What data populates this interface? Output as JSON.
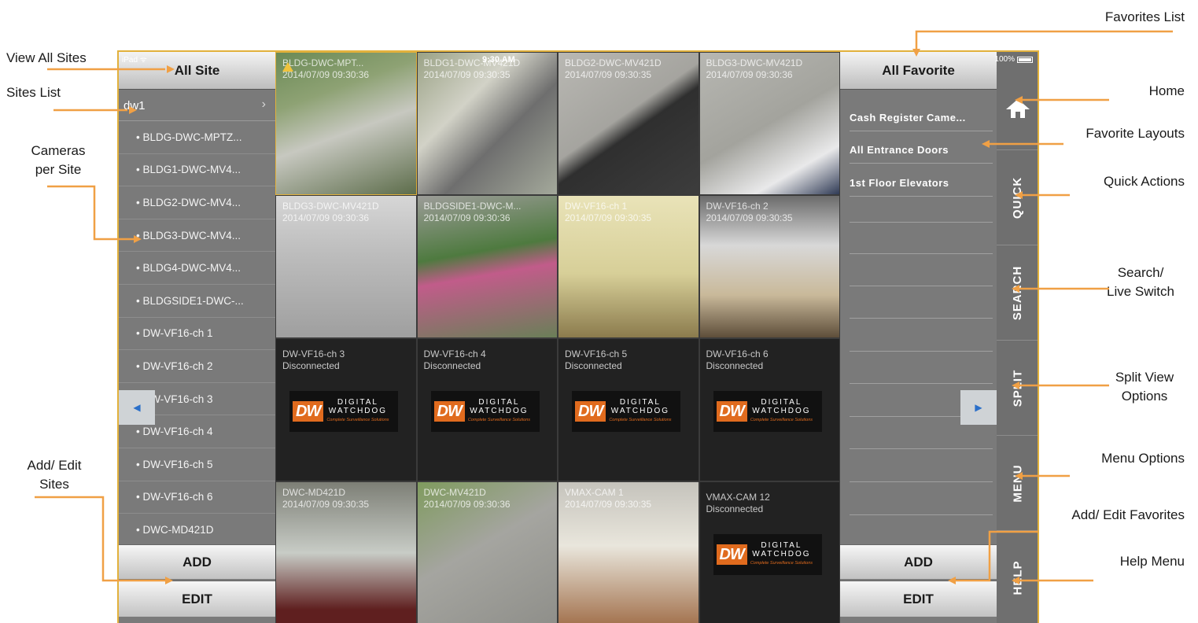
{
  "annotations": {
    "view_all_sites": "View All Sites",
    "sites_list": "Sites List",
    "cameras_per_site_1": "Cameras",
    "cameras_per_site_2": "per Site",
    "add_edit_sites_1": "Add/ Edit",
    "add_edit_sites_2": "Sites",
    "favorites_list": "Favorites List",
    "home": "Home",
    "favorite_layouts": "Favorite Layouts",
    "quick_actions": "Quick Actions",
    "search_live_1": "Search/",
    "search_live_2": "Live Switch",
    "split_view_1": "Split View",
    "split_view_2": "Options",
    "menu_options": "Menu Options",
    "add_edit_favorites": "Add/ Edit Favorites",
    "help_menu": "Help Menu"
  },
  "status": {
    "device": "iPad ᯤ",
    "time": "9:30 AM",
    "battery": "100%"
  },
  "left": {
    "header": "All Site",
    "site": "dw1",
    "chevron": "›",
    "cameras": [
      "• BLDG-DWC-MPTZ...",
      "• BLDG1-DWC-MV4...",
      "• BLDG2-DWC-MV4...",
      "• BLDG3-DWC-MV4...",
      "• BLDG4-DWC-MV4...",
      "• BLDGSIDE1-DWC-...",
      "• DW-VF16-ch 1",
      "• DW-VF16-ch 2",
      "• DW-VF16-ch 3",
      "• DW-VF16-ch 4",
      "• DW-VF16-ch 5",
      "• DW-VF16-ch 6",
      "• DWC-MD421D"
    ],
    "add": "ADD",
    "edit": "EDIT",
    "prev": "◀"
  },
  "tiles": [
    {
      "cap": "BLDG-DWC-MPT...\n2014/07/09 09:30:36",
      "scene": "s1",
      "type": "live"
    },
    {
      "cap": "BLDG1-DWC-MV421D\n2014/07/09 09:30:35",
      "scene": "s2",
      "type": "live"
    },
    {
      "cap": "BLDG2-DWC-MV421D\n2014/07/09 09:30:35",
      "scene": "s3",
      "type": "live"
    },
    {
      "cap": "BLDG3-DWC-MV421D\n2014/07/09 09:30:36",
      "scene": "s4",
      "type": "live"
    },
    {
      "cap": "BLDG3-DWC-MV421D\n2014/07/09 09:30:36",
      "scene": "s5",
      "type": "live"
    },
    {
      "cap": "BLDGSIDE1-DWC-M...\n2014/07/09 09:30:36",
      "scene": "s6",
      "type": "live"
    },
    {
      "cap": "DW-VF16-ch 1\n2014/07/09 09:30:35",
      "scene": "s7",
      "type": "live"
    },
    {
      "cap": "DW-VF16-ch 2\n2014/07/09 09:30:35",
      "scene": "s8",
      "type": "live"
    },
    {
      "cap": "DW-VF16-ch 3\nDisconnected",
      "type": "disc"
    },
    {
      "cap": "DW-VF16-ch 4\nDisconnected",
      "type": "disc"
    },
    {
      "cap": "DW-VF16-ch 5\nDisconnected",
      "type": "disc"
    },
    {
      "cap": "DW-VF16-ch 6\nDisconnected",
      "type": "disc"
    },
    {
      "cap": "DWC-MD421D\n2014/07/09 09:30:35",
      "scene": "s9",
      "type": "live"
    },
    {
      "cap": "DWC-MV421D\n2014/07/09 09:30:36",
      "scene": "s10",
      "type": "live"
    },
    {
      "cap": "VMAX-CAM 1\n2014/07/09 09:30:35",
      "scene": "s11",
      "type": "live"
    },
    {
      "cap": "VMAX-CAM 12\nDisconnected",
      "type": "disc"
    }
  ],
  "logo": {
    "mark": "DW",
    "line1": "DIGITAL",
    "line2": "WATCHDOG",
    "tagline": "Complete Surveillance Solutions"
  },
  "right": {
    "header": "All Favorite",
    "favorites": [
      "Cash Register Came...",
      "All Entrance Doors",
      "1st Floor Elevators"
    ],
    "add": "ADD",
    "edit": "EDIT",
    "next": "▶"
  },
  "sidebar": {
    "quick": "QUICK",
    "search": "SEARCH",
    "split": "SPLIT",
    "menu": "MENU",
    "help": "HELP"
  }
}
